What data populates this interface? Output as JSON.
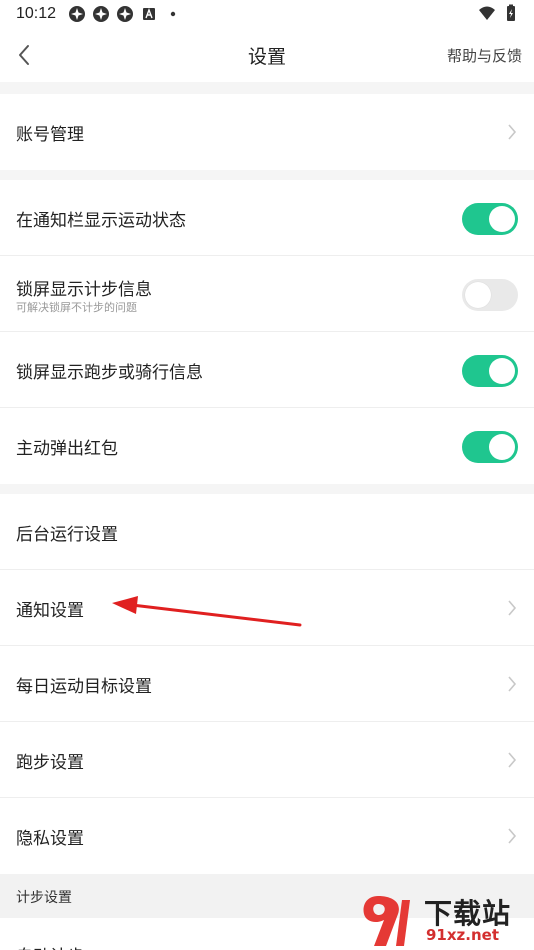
{
  "status_bar": {
    "time": "10:12",
    "notification_icons": [
      "app-notification-icon",
      "app-notification-icon",
      "app-notification-icon",
      "accessibility-icon"
    ],
    "right_icons": [
      "wifi-icon",
      "battery-charging-icon"
    ]
  },
  "header": {
    "title": "设置",
    "help_link": "帮助与反馈"
  },
  "sections": {
    "account": {
      "items": [
        {
          "label": "账号管理"
        }
      ]
    },
    "toggles": {
      "items": [
        {
          "label": "在通知栏显示运动状态",
          "on": true
        },
        {
          "label": "锁屏显示计步信息",
          "sublabel": "可解决锁屏不计步的问题",
          "on": false
        },
        {
          "label": "锁屏显示跑步或骑行信息",
          "on": true
        },
        {
          "label": "主动弹出红包",
          "on": true
        }
      ]
    },
    "settings": {
      "items": [
        {
          "label": "后台运行设置"
        },
        {
          "label": "通知设置"
        },
        {
          "label": "每日运动目标设置"
        },
        {
          "label": "跑步设置"
        },
        {
          "label": "隐私设置"
        }
      ]
    },
    "step_header": {
      "label": "计步设置"
    },
    "partial": {
      "label": "自动计步"
    }
  },
  "watermark": {
    "title": "下载站",
    "url": "91xz.net"
  },
  "colors": {
    "accent": "#1fc68f",
    "toggle_off": "#e9e9e9",
    "arrow": "#e02020",
    "background": "#f5f5f5"
  }
}
